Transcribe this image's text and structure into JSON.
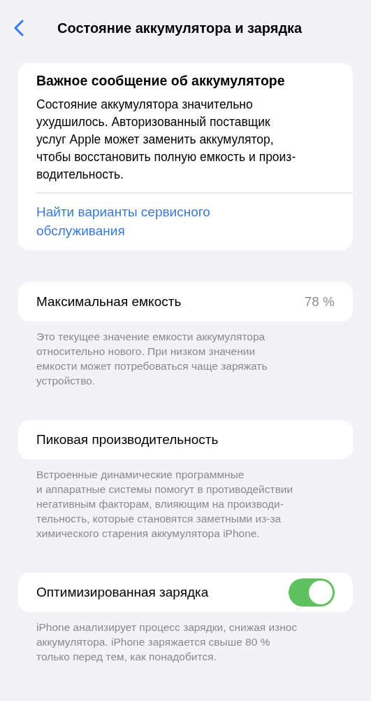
{
  "nav": {
    "title": "Состояние аккумулятора и зарядка"
  },
  "alert": {
    "title": "Важное сообщение об аккумуляторе",
    "text": "Состояние аккумулятора значительно\nухудшилось. Авторизованный поставщик\nуслуг Apple может заменить аккумулятор,\nчтобы восстановить полную емкость и произ-\nводительность.",
    "link": "Найти варианты сервисного\nобслуживания"
  },
  "settings": [
    {
      "kind": "value",
      "label": "Максимальная емкость",
      "value": "78 %",
      "footer": "Это текущее значение емкости аккумулятора\nотносительно нового. При низком значении\nемкости может потребоваться чаще заряжать\nустройство."
    },
    {
      "kind": "plain",
      "label": "Пиковая производительность",
      "footer": "Встроенные динамические программные\nи аппаратные системы помогут в противодействии\nнегативным факторам, влияющим на производи-\nтельность, которые становятся заметными из-за\nхимического старения аккумулятора iPhone."
    },
    {
      "kind": "toggle",
      "label": "Оптимизированная зарядка",
      "on": true,
      "footer": "iPhone анализирует процесс зарядки, снижая износ\nаккумулятора. iPhone заряжается свыше 80 %\nтолько перед тем, как понадобится."
    }
  ]
}
